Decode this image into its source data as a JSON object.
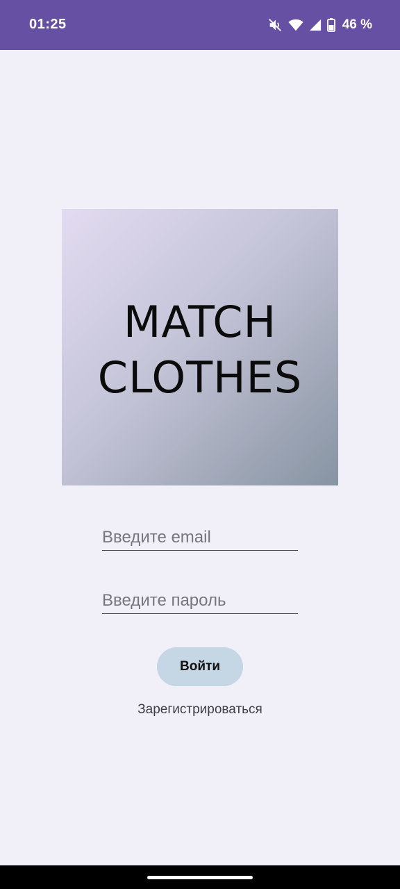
{
  "status_bar": {
    "time": "01:25",
    "battery_percent": "46 %",
    "icons": [
      "mute-icon",
      "wifi-icon",
      "signal-icon",
      "battery-icon"
    ]
  },
  "logo": {
    "line1": "MATCH",
    "line2": "CLOTHES"
  },
  "form": {
    "email_placeholder": "Введите email",
    "email_value": "",
    "password_placeholder": "Введите пароль",
    "password_value": "",
    "login_label": "Войти",
    "register_label": "Зарегистрироваться"
  },
  "colors": {
    "status_bar": "#6650a4",
    "background": "#f1f0f9",
    "login_button": "#c5d6e5"
  }
}
